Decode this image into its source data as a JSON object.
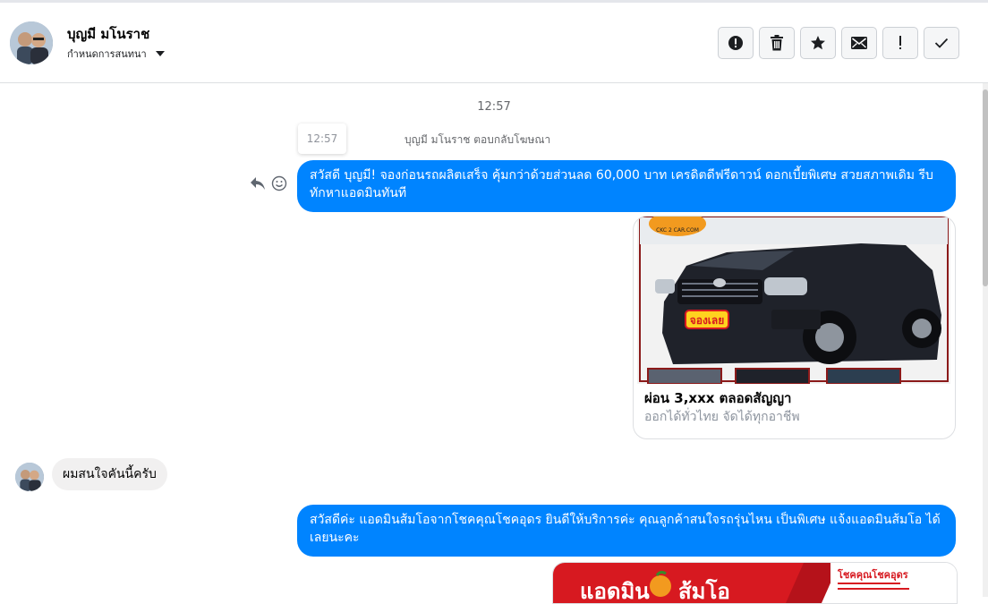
{
  "header": {
    "contact_name": "บุญมี มโนราช",
    "subtitle": "กำหนดการสนทนา",
    "actions": [
      {
        "icon": "alert-icon"
      },
      {
        "icon": "trash-icon"
      },
      {
        "icon": "star-icon"
      },
      {
        "icon": "envelope-icon"
      },
      {
        "icon": "exclamation-icon"
      },
      {
        "icon": "check-icon"
      }
    ]
  },
  "conversation": {
    "timestamp": "12:57",
    "tooltip_time": "12:57",
    "ad_reply_notice": "บุญมี มโนราช ตอบกลับโฆษณา",
    "messages": [
      {
        "direction": "outgoing",
        "text": "สวัสดี บุญมี! จองก่อนรถผลิตเสร็จ คุ้มกว่าด้วยส่วนลด 60,000 บาท เครดิตดีฟรีดาวน์ ดอกเบี้ยพิเศษ สวยสภาพเดิม รีบทักหาแอดมินทันที"
      },
      {
        "direction": "incoming",
        "text": "ผมสนใจคันนี้ครับ"
      },
      {
        "direction": "outgoing",
        "text": "สวัสดีค่ะ แอดมินส้มโอจากโชคคุณโชคอุดร ยินดีให้บริการค่ะ  คุณลูกค้าสนใจรถรุ่นไหน เป็นพิเศษ แจ้งแอดมินส้มโอ ได้เลยนะคะ"
      }
    ],
    "ad_card": {
      "logo_text": "CKC 2 CAR.COM",
      "badge_text": "จองเลย",
      "title": "ผ่อน 3,xxx ตลอดสัญญา",
      "subtitle": "ออกได้ทั่วไทย จัดได้ทุกอาชีพ"
    },
    "banner": {
      "left_text": "แอดมิน",
      "right_text": "ส้มโอ",
      "brand": "โชคคุณโชคอุดร"
    }
  },
  "colors": {
    "outgoing_bubble": "#0084ff",
    "incoming_bubble": "#f1f0f0",
    "banner_red": "#d71920"
  }
}
